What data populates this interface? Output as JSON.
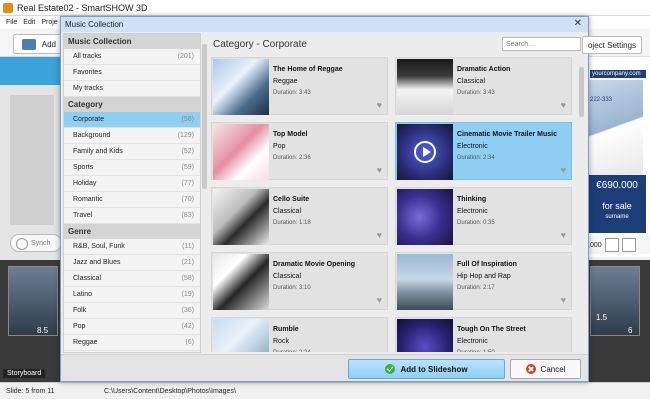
{
  "window": {
    "title": "Real Estate02 - SmartSHOW 3D"
  },
  "menu": {
    "items": [
      "File",
      "Edit",
      "Proje"
    ]
  },
  "toolbar": {
    "add_label": "Add",
    "project_settings_label": "oject Settings"
  },
  "left_panel": {
    "sync_label": "Synch"
  },
  "right_panel": {
    "company": "yourcompany.com",
    "phone": "222-333",
    "price": "€690.000",
    "sale": "for sale",
    "name": "surname",
    "value": ",000"
  },
  "storyboard": {
    "label": "Storyboard",
    "slide_left_duration": "8.5",
    "slide_right_duration": "1.5",
    "slide_right_index": "6"
  },
  "statusbar": {
    "slide_info": "Slide: 5 from 11",
    "path": "C:\\Users\\Content\\Desktop\\Photos\\Images\\"
  },
  "dialog": {
    "title": "Music Collection",
    "close_icon": "close-icon",
    "search_placeholder": "Search...",
    "section_heading": "Category - Corporate",
    "sidebar": {
      "collection_header": "Music Collection",
      "collection_items": [
        {
          "label": "All tracks",
          "count": "(201)"
        },
        {
          "label": "Favorites",
          "count": ""
        },
        {
          "label": "My tracks",
          "count": ""
        }
      ],
      "category_header": "Category",
      "category_items": [
        {
          "label": "Corporate",
          "count": "(58)"
        },
        {
          "label": "Background",
          "count": "(129)"
        },
        {
          "label": "Family and Kids",
          "count": "(52)"
        },
        {
          "label": "Sports",
          "count": "(59)"
        },
        {
          "label": "Holiday",
          "count": "(77)"
        },
        {
          "label": "Romantic",
          "count": "(70)"
        },
        {
          "label": "Travel",
          "count": "(83)"
        }
      ],
      "genre_header": "Genre",
      "genre_items": [
        {
          "label": "R&B, Soul, Funk",
          "count": "(11)"
        },
        {
          "label": "Jazz and Blues",
          "count": "(21)"
        },
        {
          "label": "Classical",
          "count": "(58)"
        },
        {
          "label": "Latino",
          "count": "(19)"
        },
        {
          "label": "Folk",
          "count": "(36)"
        },
        {
          "label": "Pop",
          "count": "(42)"
        },
        {
          "label": "Reggae",
          "count": "(6)"
        }
      ]
    },
    "tracks": [
      {
        "title": "The Home of Reggae",
        "genre": "Reggae",
        "duration": "Duration: 3:43",
        "selected": false,
        "thumb": "t0"
      },
      {
        "title": "Dramatic Action",
        "genre": "Classical",
        "duration": "Duration: 3:43",
        "selected": false,
        "thumb": "t1"
      },
      {
        "title": "Top Model",
        "genre": "Pop",
        "duration": "Duration: 2:36",
        "selected": false,
        "thumb": "t2"
      },
      {
        "title": "Cinematic Movie Trailer Music",
        "genre": "Electronic",
        "duration": "Duration: 2:34",
        "selected": true,
        "thumb": "t3"
      },
      {
        "title": "Cello Suite",
        "genre": "Classical",
        "duration": "Duration: 1:18",
        "selected": false,
        "thumb": "t4"
      },
      {
        "title": "Thinking",
        "genre": "Electronic",
        "duration": "Duration: 0:35",
        "selected": false,
        "thumb": "t5"
      },
      {
        "title": "Dramatic Movie Opening",
        "genre": "Classical",
        "duration": "Duration: 3:10",
        "selected": false,
        "thumb": "t6"
      },
      {
        "title": "Full Of Inspiration",
        "genre": "Hip Hop and Rap",
        "duration": "Duration: 2:17",
        "selected": false,
        "thumb": "t7"
      },
      {
        "title": "Rumble",
        "genre": "Rock",
        "duration": "Duration: 2:24",
        "selected": false,
        "thumb": "t8"
      },
      {
        "title": "Tough On The Street",
        "genre": "Electronic",
        "duration": "Duration: 1:50",
        "selected": false,
        "thumb": "t9"
      }
    ],
    "add_button_label": "Add to Slideshow",
    "cancel_button_label": "Cancel"
  }
}
